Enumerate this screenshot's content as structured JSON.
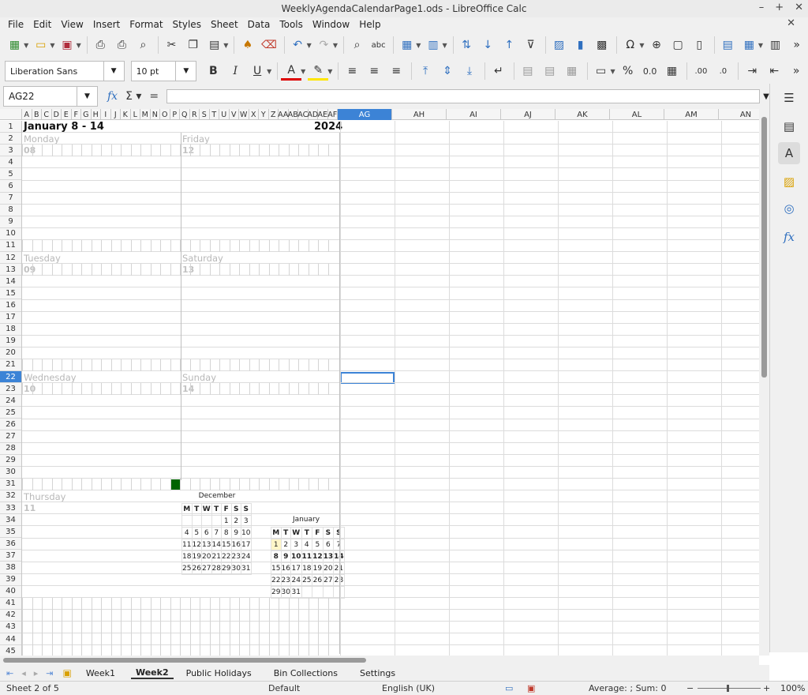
{
  "window": {
    "title": "WeeklyAgendaCalendarPage1.ods - LibreOffice Calc"
  },
  "menu": [
    "File",
    "Edit",
    "View",
    "Insert",
    "Format",
    "Styles",
    "Sheet",
    "Data",
    "Tools",
    "Window",
    "Help"
  ],
  "font": {
    "name": "Liberation Sans",
    "size": "10 pt"
  },
  "namebox": "AG22",
  "columns": [
    "A",
    "B",
    "C",
    "D",
    "E",
    "F",
    "G",
    "H",
    "I",
    "J",
    "K",
    "L",
    "M",
    "N",
    "O",
    "P",
    "Q",
    "R",
    "S",
    "T",
    "U",
    "V",
    "W",
    "X",
    "Y",
    "Z",
    "AA",
    "AB",
    "AC",
    "AD",
    "AE",
    "AF",
    "AG",
    "AH",
    "AI",
    "AJ",
    "AK",
    "AL",
    "AM",
    "AN"
  ],
  "rows": [
    "1",
    "2",
    "3",
    "4",
    "5",
    "6",
    "7",
    "8",
    "9",
    "10",
    "11",
    "12",
    "13",
    "14",
    "15",
    "16",
    "17",
    "18",
    "19",
    "20",
    "21",
    "22",
    "23",
    "24",
    "25",
    "26",
    "27",
    "28",
    "29",
    "30",
    "31",
    "32",
    "33",
    "34",
    "35",
    "36",
    "37",
    "38",
    "39",
    "40",
    "41",
    "42",
    "43",
    "44",
    "45"
  ],
  "sheet": {
    "week_title": "January 8 - 14",
    "year": "2024",
    "days": [
      {
        "name": "Monday",
        "num": "08"
      },
      {
        "name": "Friday",
        "num": "12"
      },
      {
        "name": "Tuesday",
        "num": "09"
      },
      {
        "name": "Saturday",
        "num": "13"
      },
      {
        "name": "Wednesday",
        "num": "10"
      },
      {
        "name": "Sunday",
        "num": "14"
      },
      {
        "name": "Thursday",
        "num": "11"
      }
    ]
  },
  "mini_december": {
    "title": "December",
    "head": [
      "M",
      "T",
      "W",
      "T",
      "F",
      "S",
      "S"
    ],
    "weeks": [
      [
        "",
        "",
        "",
        "",
        "1",
        "2",
        "3"
      ],
      [
        "4",
        "5",
        "6",
        "7",
        "8",
        "9",
        "10"
      ],
      [
        "11",
        "12",
        "13",
        "14",
        "15",
        "16",
        "17"
      ],
      [
        "18",
        "19",
        "20",
        "21",
        "22",
        "23",
        "24"
      ],
      [
        "25",
        "26",
        "27",
        "28",
        "29",
        "30",
        "31"
      ]
    ]
  },
  "mini_january": {
    "title": "January",
    "head": [
      "M",
      "T",
      "W",
      "T",
      "F",
      "S",
      "S"
    ],
    "weeks": [
      [
        "1",
        "2",
        "3",
        "4",
        "5",
        "6",
        "7"
      ],
      [
        "8",
        "9",
        "10",
        "11",
        "12",
        "13",
        "14"
      ],
      [
        "15",
        "16",
        "17",
        "18",
        "19",
        "20",
        "21"
      ],
      [
        "22",
        "23",
        "24",
        "25",
        "26",
        "27",
        "28"
      ],
      [
        "29",
        "30",
        "31",
        "",
        "",
        "",
        ""
      ]
    ]
  },
  "tabs": [
    "Week1",
    "Week2",
    "Public Holidays",
    "Bin Collections",
    "Settings"
  ],
  "active_tab": "Week2",
  "status": {
    "sheet": "Sheet 2 of 5",
    "style": "Default",
    "lang": "English (UK)",
    "sum": "Average: ; Sum: 0",
    "zoom": "100%"
  },
  "colors": {
    "accent": "#3c83d6",
    "green_marker": "#006400"
  }
}
